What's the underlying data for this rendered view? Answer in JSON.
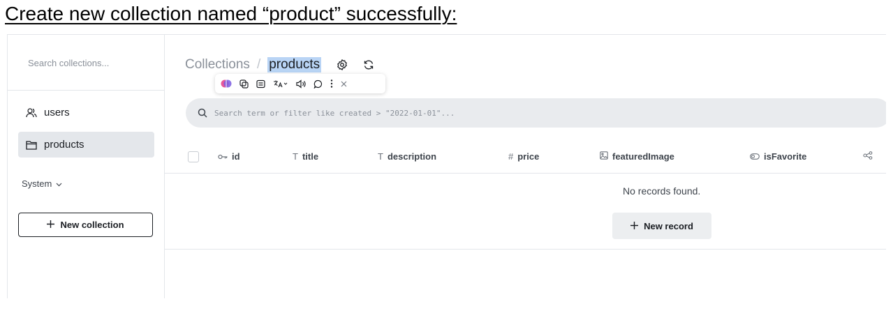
{
  "heading": "Create new collection named “product” successfully:",
  "sidebar": {
    "search_placeholder": "Search collections...",
    "items": [
      {
        "label": "users",
        "icon": "users-icon"
      },
      {
        "label": "products",
        "icon": "folder-icon",
        "active": true
      }
    ],
    "system_label": "System",
    "new_collection_label": "New collection"
  },
  "main": {
    "breadcrumb_root": "Collections",
    "breadcrumb_sep": "/",
    "breadcrumb_current": "products",
    "filter_placeholder": "Search term or filter like created > \"2022-01-01\"...",
    "columns": [
      {
        "label": "id",
        "glyph": "key-icon"
      },
      {
        "label": "title",
        "glyph": "T"
      },
      {
        "label": "description",
        "glyph": "T"
      },
      {
        "label": "price",
        "glyph": "#"
      },
      {
        "label": "featuredImage",
        "glyph": "image-icon"
      },
      {
        "label": "isFavorite",
        "glyph": "toggle-icon"
      }
    ],
    "empty_message": "No records found.",
    "new_record_label": "New record"
  },
  "colors": {
    "selected_bg": "#e4e7eb",
    "highlight": "#b9d4f5",
    "filter_bg": "#e9ebee"
  }
}
